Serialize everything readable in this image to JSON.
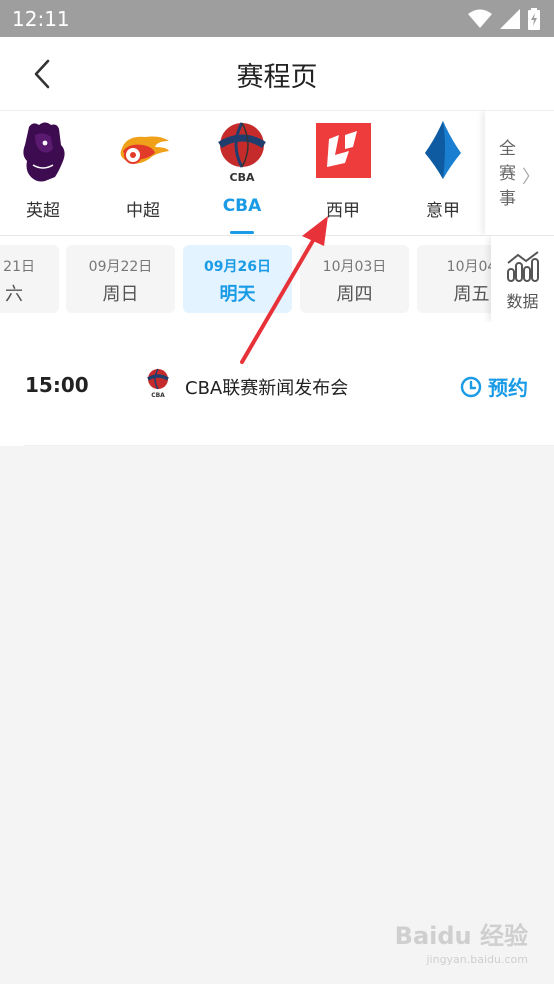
{
  "status_bar": {
    "time": "12:11"
  },
  "header": {
    "title": "赛程页"
  },
  "leagues": [
    {
      "name": "英超",
      "logo": "premier-league-lion-icon"
    },
    {
      "name": "中超",
      "logo": "chinese-super-league-icon"
    },
    {
      "name": "CBA",
      "logo": "cba-basketball-icon",
      "active": true
    },
    {
      "name": "西甲",
      "logo": "laliga-icon"
    },
    {
      "name": "意甲",
      "logo": "serie-a-icon"
    }
  ],
  "all_leagues": {
    "label_1": "全",
    "label_2": "赛",
    "label_3": "事"
  },
  "dates": [
    {
      "date": "21日",
      "weekday": "六"
    },
    {
      "date": "09月22日",
      "weekday": "周日"
    },
    {
      "date": "09月26日",
      "weekday": "明天",
      "active": true
    },
    {
      "date": "10月03日",
      "weekday": "周四"
    },
    {
      "date": "10月04",
      "weekday": "周五"
    }
  ],
  "stats": {
    "label": "数据"
  },
  "match": {
    "time": "15:00",
    "title": "CBA联赛新闻发布会",
    "action": "预约"
  },
  "watermark": {
    "brand": "Baidu 经验",
    "url": "jingyan.baidu.com"
  },
  "colors": {
    "accent": "#1a9be6",
    "arrow": "#e8323a",
    "laliga": "#ee3b3b"
  }
}
